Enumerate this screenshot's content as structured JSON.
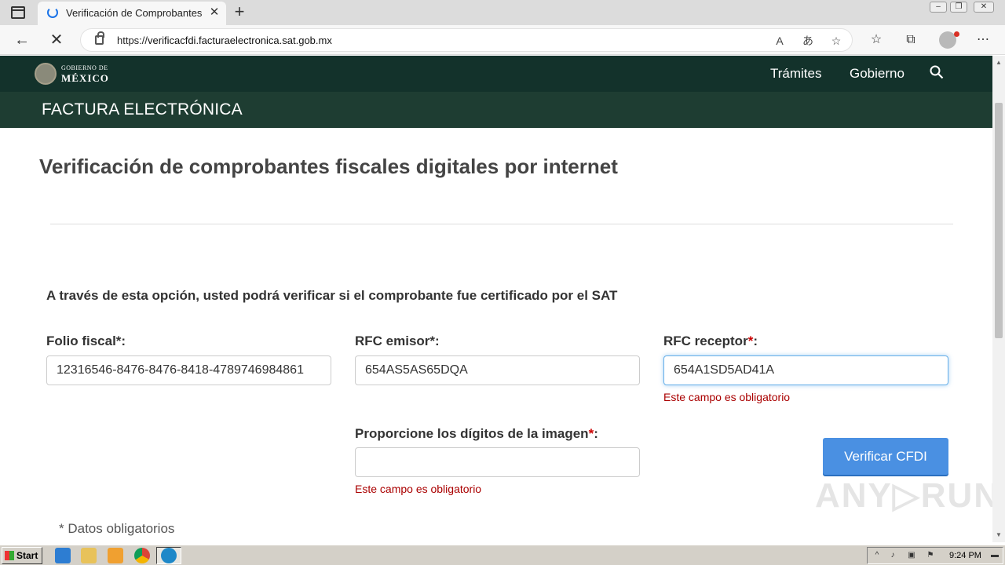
{
  "browser": {
    "tab_title": "Verificación de Comprobantes Fi",
    "url_prefix": "https://",
    "url_host": "verificacfdi.facturaelectronica.sat.gob.mx"
  },
  "gob_header": {
    "logo_line1": "GOBIERNO DE",
    "logo_line2": "MÉXICO",
    "nav": [
      "Trámites",
      "Gobierno"
    ]
  },
  "sub_header": {
    "title": "FACTURA ELECTRÓNICA"
  },
  "main": {
    "title": "Verificación de comprobantes fiscales digitales por internet",
    "intro": "A través de esta opción, usted podrá verificar si el comprobante fue certificado por el SAT",
    "fields": {
      "folio": {
        "label": "Folio fiscal",
        "req": "*",
        "colon": ":",
        "value": "12316546-8476-8476-8418-4789746984861"
      },
      "rfc_emisor": {
        "label": "RFC emisor",
        "req": "*",
        "colon": ":",
        "value": "654AS5AS65DQA"
      },
      "rfc_receptor": {
        "label": "RFC receptor",
        "req": "*",
        "colon": ":",
        "value": "654A1SD5AD41A",
        "error": "Este campo es obligatorio"
      },
      "captcha": {
        "label": "Proporcione los dígitos de la imagen",
        "req": "*",
        "colon": ":",
        "value": "",
        "error": "Este campo es obligatorio"
      }
    },
    "verify_button": "Verificar CFDI",
    "footnote": "* Datos obligatorios"
  },
  "watermark": "ANY▷RUN",
  "taskbar": {
    "start": "Start",
    "clock": "9:24 PM"
  },
  "colors": {
    "gob_green": "#13322b",
    "sub_green": "#1e3d32",
    "button_blue": "#4a90e2",
    "error_red": "#a00"
  }
}
